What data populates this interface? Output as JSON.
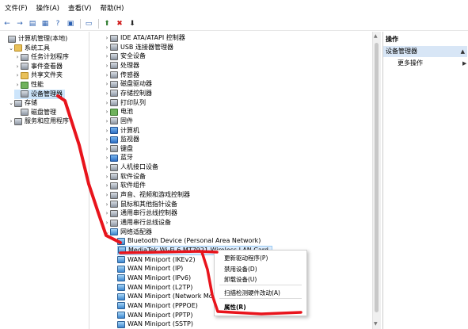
{
  "menu": [
    "文件(F)",
    "操作(A)",
    "查看(V)",
    "帮助(H)"
  ],
  "toolbar": [
    "back-icon",
    "forward-icon",
    "folder-icon",
    "properties-icon",
    "help-icon",
    "console-icon",
    "sep",
    "monitor-icon",
    "sep",
    "update-driver-icon",
    "delete-icon",
    "download-icon"
  ],
  "left_tree": [
    {
      "label": "计算机管理(本地)",
      "indent": 0,
      "arrow": "",
      "icon": "dev"
    },
    {
      "label": "系统工具",
      "indent": 1,
      "arrow": "v",
      "icon": "fold"
    },
    {
      "label": "任务计划程序",
      "indent": 2,
      "arrow": ">",
      "icon": "dev"
    },
    {
      "label": "事件查看器",
      "indent": 2,
      "arrow": ">",
      "icon": "dev"
    },
    {
      "label": "共享文件夹",
      "indent": 2,
      "arrow": ">",
      "icon": "fold"
    },
    {
      "label": "性能",
      "indent": 2,
      "arrow": ">",
      "icon": "green"
    },
    {
      "label": "设备管理器",
      "indent": 2,
      "arrow": "",
      "icon": "dev",
      "selected": true
    },
    {
      "label": "存储",
      "indent": 1,
      "arrow": "v",
      "icon": "dev"
    },
    {
      "label": "磁盘管理",
      "indent": 2,
      "arrow": "",
      "icon": "dev"
    },
    {
      "label": "服务和应用程序",
      "indent": 1,
      "arrow": ">",
      "icon": "dev"
    }
  ],
  "device_tree": [
    {
      "label": "IDE ATA/ATAPI 控制器",
      "arrow": ">",
      "icon": "dev"
    },
    {
      "label": "USB 连接器管理器",
      "arrow": ">",
      "icon": "dev"
    },
    {
      "label": "安全设备",
      "arrow": ">",
      "icon": "dev"
    },
    {
      "label": "处理器",
      "arrow": ">",
      "icon": "dev"
    },
    {
      "label": "传感器",
      "arrow": ">",
      "icon": "dev"
    },
    {
      "label": "磁盘驱动器",
      "arrow": ">",
      "icon": "dev"
    },
    {
      "label": "存储控制器",
      "arrow": ">",
      "icon": "dev"
    },
    {
      "label": "打印队列",
      "arrow": ">",
      "icon": "dev"
    },
    {
      "label": "电池",
      "arrow": ">",
      "icon": "green"
    },
    {
      "label": "固件",
      "arrow": ">",
      "icon": "dev"
    },
    {
      "label": "计算机",
      "arrow": ">",
      "icon": "blue"
    },
    {
      "label": "监视器",
      "arrow": ">",
      "icon": "blue"
    },
    {
      "label": "键盘",
      "arrow": ">",
      "icon": "dev"
    },
    {
      "label": "蓝牙",
      "arrow": ">",
      "icon": "blue"
    },
    {
      "label": "人机接口设备",
      "arrow": ">",
      "icon": "dev"
    },
    {
      "label": "软件设备",
      "arrow": ">",
      "icon": "dev"
    },
    {
      "label": "软件组件",
      "arrow": ">",
      "icon": "dev"
    },
    {
      "label": "声音、视频和游戏控制器",
      "arrow": ">",
      "icon": "dev"
    },
    {
      "label": "鼠标和其他指针设备",
      "arrow": ">",
      "icon": "dev"
    },
    {
      "label": "通用串行总线控制器",
      "arrow": ">",
      "icon": "dev"
    },
    {
      "label": "通用串行总线设备",
      "arrow": ">",
      "icon": "dev"
    },
    {
      "label": "网络适配器",
      "arrow": "v",
      "icon": "net"
    },
    {
      "label": "Bluetooth Device (Personal Area Network)",
      "arrow": "",
      "icon": "net",
      "child": true
    },
    {
      "label": "MediaTek Wi-Fi 6 MT7921 Wireless LAN Card",
      "arrow": "",
      "icon": "net",
      "child": true,
      "selected": true
    },
    {
      "label": "WAN Miniport (IKEv2)",
      "arrow": "",
      "icon": "net",
      "child": true
    },
    {
      "label": "WAN Miniport (IP)",
      "arrow": "",
      "icon": "net",
      "child": true
    },
    {
      "label": "WAN Miniport (IPv6)",
      "arrow": "",
      "icon": "net",
      "child": true
    },
    {
      "label": "WAN Miniport (L2TP)",
      "arrow": "",
      "icon": "net",
      "child": true
    },
    {
      "label": "WAN Miniport (Network Mo",
      "arrow": "",
      "icon": "net",
      "child": true
    },
    {
      "label": "WAN Miniport (PPPOE)",
      "arrow": "",
      "icon": "net",
      "child": true
    },
    {
      "label": "WAN Miniport (PPTP)",
      "arrow": "",
      "icon": "net",
      "child": true
    },
    {
      "label": "WAN Miniport (SSTP)",
      "arrow": "",
      "icon": "net",
      "child": true
    }
  ],
  "actions": {
    "header": "操作",
    "section": "设备管理器",
    "more": "更多操作"
  },
  "context_menu": [
    {
      "label": "更新驱动程序(P)",
      "bold": false
    },
    {
      "label": "禁用设备(D)",
      "bold": false
    },
    {
      "label": "卸载设备(U)",
      "bold": false
    },
    {
      "sep": true
    },
    {
      "label": "扫描检测硬件改动(A)",
      "bold": false
    },
    {
      "sep": true
    },
    {
      "label": "属性(R)",
      "bold": true
    }
  ],
  "colors": {
    "annotation": "#e8141c",
    "selection": "#cde5fb",
    "header": "#d8e6f6"
  }
}
